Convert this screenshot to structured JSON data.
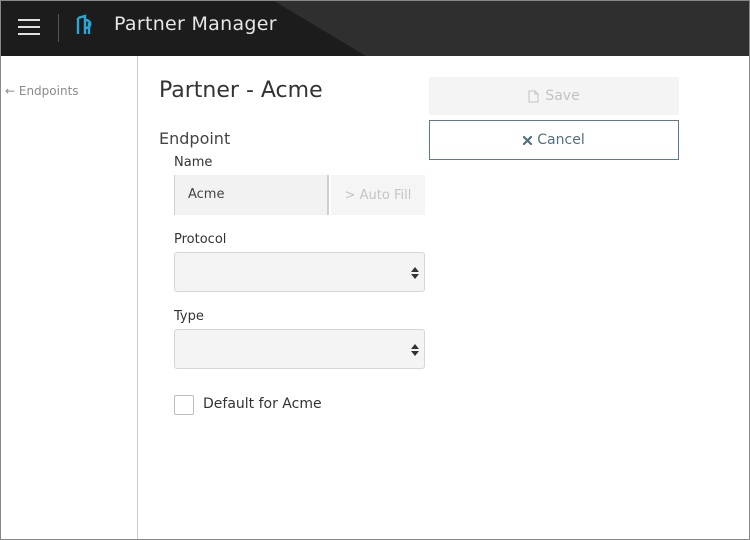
{
  "header": {
    "app_title": "Partner Manager",
    "menu_icon": "hamburger-menu-icon",
    "logo_icon": "app-logo-icon"
  },
  "sidebar": {
    "back_link": "← Endpoints"
  },
  "main": {
    "page_title": "Partner - Acme",
    "section_title": "Endpoint",
    "name": {
      "label": "Name",
      "value": "Acme",
      "autofill_label": "> Auto Fill"
    },
    "protocol": {
      "label": "Protocol",
      "selected": ""
    },
    "type": {
      "label": "Type",
      "selected": ""
    },
    "default_checkbox": {
      "label": "Default for Acme",
      "checked": false
    }
  },
  "actions": {
    "save_label": "Save",
    "cancel_label": "Cancel"
  },
  "colors": {
    "header_bg": "#2f2f2f",
    "logo_accent": "#2aa7d6",
    "cancel_border": "#5c7a8e"
  }
}
